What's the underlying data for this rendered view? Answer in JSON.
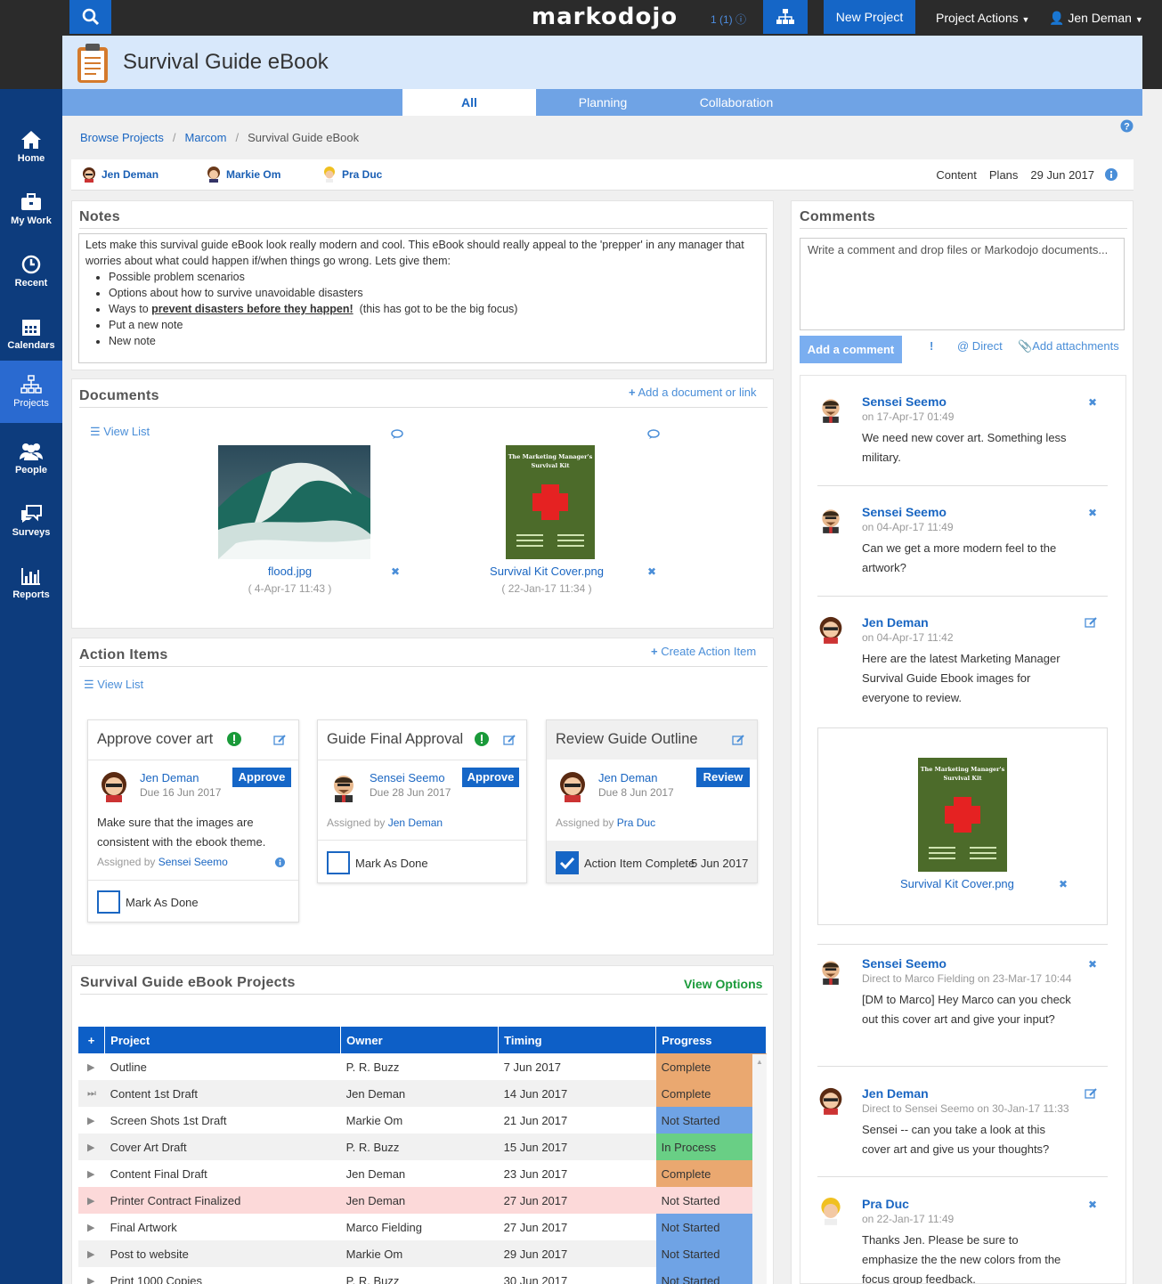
{
  "topbar": {
    "logo": "markodojo",
    "notifications": "1 (1)",
    "new_project": "New Project",
    "project_actions": "Project Actions",
    "user": "Jen Deman"
  },
  "sidebar": {
    "items": [
      {
        "label": "Home"
      },
      {
        "label": "My Work"
      },
      {
        "label": "Recent"
      },
      {
        "label": "Calendars"
      },
      {
        "label": "Projects"
      },
      {
        "label": "People"
      },
      {
        "label": "Surveys"
      },
      {
        "label": "Reports"
      }
    ]
  },
  "title": "Survival Guide eBook",
  "tabs": [
    "All",
    "Planning",
    "Collaboration"
  ],
  "breadcrumb": [
    "Browse Projects",
    "Marcom",
    "Survival Guide eBook"
  ],
  "people": [
    "Jen Deman",
    "Markie Om",
    "Pra Duc"
  ],
  "peoplebar_right": {
    "content": "Content",
    "plans": "Plans",
    "date": "29 Jun 2017"
  },
  "notes": {
    "heading": "Notes",
    "intro": "Lets make this survival guide eBook look really modern and cool.    This eBook should really appeal to the 'prepper' in any manager that worries about what could happen if/when things go wrong.   Lets give them:",
    "items": [
      "Possible problem scenarios",
      "Options about how to survive unavoidable disasters",
      "Put a new note",
      "New note"
    ],
    "ways_prefix": "Ways to ",
    "ways_emph": "prevent disasters before they happen!",
    "ways_suffix": "  (this has got to be the big focus)"
  },
  "documents": {
    "heading": "Documents",
    "add_link": "Add a document or link",
    "view_list": "View List",
    "files": [
      {
        "name": "flood.jpg",
        "date": "( 4-Apr-17 11:43 )"
      },
      {
        "name": "Survival Kit Cover.png",
        "date": "( 22-Jan-17 11:34 )"
      }
    ],
    "cover_title": "The Marketing Manager's Survival Kit"
  },
  "action_items": {
    "heading": "Action Items",
    "create": "Create Action Item",
    "view_list": "View List",
    "cards": [
      {
        "title": "Approve cover art",
        "owner": "Jen Deman",
        "due": "Due 16 Jun 2017",
        "button": "Approve",
        "text": "Make sure that the images are consistent with the ebook theme.",
        "assigned_prefix": "Assigned by ",
        "assigned_by": "Sensei Seemo",
        "done_label": "Mark As Done"
      },
      {
        "title": "Guide Final Approval",
        "owner": "Sensei Seemo",
        "due": "Due 28 Jun 2017",
        "button": "Approve",
        "assigned_prefix": "Assigned by ",
        "assigned_by": "Jen Deman",
        "done_label": "Mark As Done"
      },
      {
        "title": "Review Guide Outline",
        "owner": "Jen Deman",
        "due": "Due 8 Jun 2017",
        "button": "Review",
        "assigned_prefix": "Assigned by ",
        "assigned_by": "Pra Duc",
        "done_label": "Action Item Complete",
        "done_date": "5 Jun 2017"
      }
    ]
  },
  "projects": {
    "heading": "Survival Guide eBook Projects",
    "view_options": "View Options",
    "columns": [
      "Project",
      "Owner",
      "Timing",
      "Progress"
    ],
    "rows": [
      {
        "project": "Outline",
        "owner": "P. R. Buzz",
        "timing": "7 Jun 2017",
        "progress": "Complete"
      },
      {
        "project": "Content 1st Draft",
        "owner": "Jen Deman",
        "timing": "14 Jun 2017",
        "progress": "Complete"
      },
      {
        "project": "Screen Shots 1st Draft",
        "owner": "Markie Om",
        "timing": "21 Jun 2017",
        "progress": "Not Started"
      },
      {
        "project": "Cover Art Draft",
        "owner": "P. R. Buzz",
        "timing": "15 Jun 2017",
        "progress": "In Process"
      },
      {
        "project": "Content Final Draft",
        "owner": "Jen Deman",
        "timing": "23 Jun 2017",
        "progress": "Complete"
      },
      {
        "project": "Printer Contract Finalized",
        "owner": "Jen Deman",
        "timing": "27 Jun 2017",
        "progress": "Not Started"
      },
      {
        "project": "Final Artwork",
        "owner": "Marco Fielding",
        "timing": "27 Jun 2017",
        "progress": "Not Started"
      },
      {
        "project": "Post to website",
        "owner": "Markie Om",
        "timing": "29 Jun 2017",
        "progress": "Not Started"
      },
      {
        "project": "Print 1000 Copies",
        "owner": "P. R. Buzz",
        "timing": "30 Jun 2017",
        "progress": "Not Started"
      }
    ]
  },
  "comments": {
    "heading": "Comments",
    "placeholder": "Write a comment and drop files or Markodojo documents...",
    "add_button": "Add a comment",
    "important": "!",
    "direct": "@ Direct",
    "attachments": "Add attachments",
    "items": [
      {
        "name": "Sensei Seemo",
        "meta": "on 17-Apr-17 01:49",
        "body": "We need new cover art.  Something less military."
      },
      {
        "name": "Sensei Seemo",
        "meta": "on 04-Apr-17 11:49",
        "body": "Can we get a  more modern feel to the artwork?"
      },
      {
        "name": "Jen Deman",
        "meta": "on 04-Apr-17 11:42",
        "body": "Here are the latest Marketing Manager Survival Guide Ebook images for everyone to review."
      },
      {
        "name": "Sensei Seemo",
        "meta": "Direct to Marco Fielding on 23-Mar-17 10:44",
        "body": "[DM to Marco] Hey Marco can you check out this cover art and give your input?"
      },
      {
        "name": "Jen Deman",
        "meta": "Direct to Sensei Seemo on 30-Jan-17 11:33",
        "body": "Sensei -- can you take a look at this cover art and give us your thoughts?"
      },
      {
        "name": "Pra Duc",
        "meta": "on 22-Jan-17 11:49",
        "body": "Thanks Jen. Please be sure to emphasize the the new colors from the focus group feedback."
      }
    ],
    "attachment_name": "Survival Kit Cover.png"
  },
  "colors": {
    "primary": "#1566c7",
    "complete": "#eaa870",
    "not_started": "#6fa3e5",
    "in_process": "#69cf85",
    "green": "#1a9a3a"
  }
}
